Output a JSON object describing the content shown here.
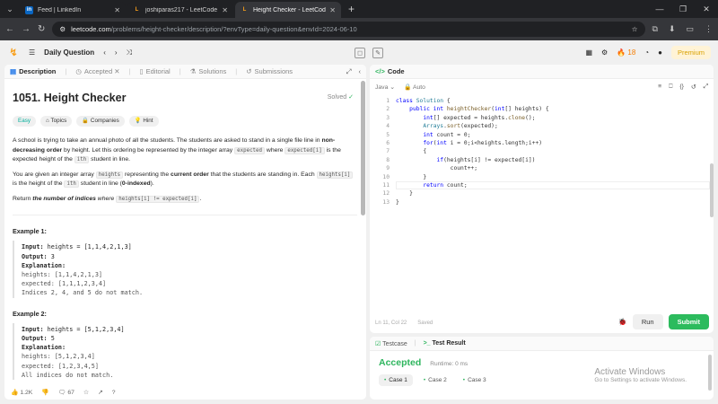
{
  "browser": {
    "tabs": [
      {
        "title": "Feed | LinkedIn",
        "icon": "linkedin-icon",
        "color": "#0a66c2",
        "glyph": "in"
      },
      {
        "title": "joshiparas217 - LeetCode Profi",
        "icon": "leetcode-icon",
        "color": "#f89f1b",
        "glyph": "L"
      },
      {
        "title": "Height Checker - LeetCode",
        "icon": "leetcode-icon",
        "color": "#f89f1b",
        "glyph": "L"
      }
    ],
    "url_host": "leetcode.com",
    "url_path": "/problems/height-checker/description/?envType=daily-question&envId=2024-06-10"
  },
  "header": {
    "section": "Daily Question",
    "streak": "18",
    "premium": "Premium"
  },
  "left": {
    "tabs": [
      "Description",
      "Accepted",
      "Editorial",
      "Solutions",
      "Submissions"
    ],
    "title": "1051. Height Checker",
    "solved": "Solved",
    "chips": [
      "Easy",
      "Topics",
      "Companies",
      "Hint"
    ],
    "desc": {
      "p1_a": "A school is trying to take an annual photo of all the students. The students are asked to stand in a single file line in ",
      "p1_b": "non-decreasing order",
      "p1_c": " by height. Let this ordering be represented by the integer array ",
      "p1_code1": "expected",
      "p1_d": " where ",
      "p1_code2": "expected[i]",
      "p1_e": " is the expected height of the ",
      "p1_sup": "ith",
      "p1_f": " student in line.",
      "p2_a": "You are given an integer array ",
      "p2_code1": "heights",
      "p2_b": " representing the ",
      "p2_bold": "current order",
      "p2_c": " that the students are standing in. Each ",
      "p2_code2": "heights[i]",
      "p2_d": " is the height of the ",
      "p2_sup": "ith",
      "p2_e": " student in line (",
      "p2_bold2": "0-indexed",
      "p2_f": ").",
      "p3_a": "Return ",
      "p3_bold": "the number of indices",
      "p3_b": " where ",
      "p3_code": "heights[i] != expected[i]",
      "p3_c": "."
    },
    "example1": {
      "title": "Example 1:",
      "input_label": "Input:",
      "input": "heights = [1,1,4,2,1,3]",
      "output_label": "Output:",
      "output": "3",
      "expl_label": "Explanation:",
      "line1": "heights:  [1,1,4,2,1,3]",
      "line2": "expected: [1,1,1,2,3,4]",
      "line3": "Indices 2, 4, and 5 do not match."
    },
    "example2": {
      "title": "Example 2:",
      "input_label": "Input:",
      "input": "heights = [5,1,2,3,4]",
      "output_label": "Output:",
      "output": "5",
      "expl_label": "Explanation:",
      "line1": "heights:  [5,1,2,3,4]",
      "line2": "expected: [1,2,3,4,5]",
      "line3": "All indices do not match."
    },
    "footer": {
      "likes": "1.2K",
      "comments": "67"
    }
  },
  "code": {
    "title": "Code",
    "language": "Java",
    "mode": "Auto",
    "line_numbers": [
      "1",
      "2",
      "3",
      "4",
      "5",
      "6",
      "7",
      "8",
      "9",
      "10",
      "11",
      "12",
      "13"
    ],
    "status_pos": "Ln 11, Col 22",
    "status_saved": "Saved",
    "run": "Run",
    "submit": "Submit"
  },
  "test": {
    "tab1": "Testcase",
    "tab2": "Test Result",
    "accepted": "Accepted",
    "runtime": "Runtime: 0 ms",
    "cases": [
      "Case 1",
      "Case 2",
      "Case 3"
    ],
    "watermark_title": "Activate Windows",
    "watermark_sub": "Go to Settings to activate Windows."
  }
}
